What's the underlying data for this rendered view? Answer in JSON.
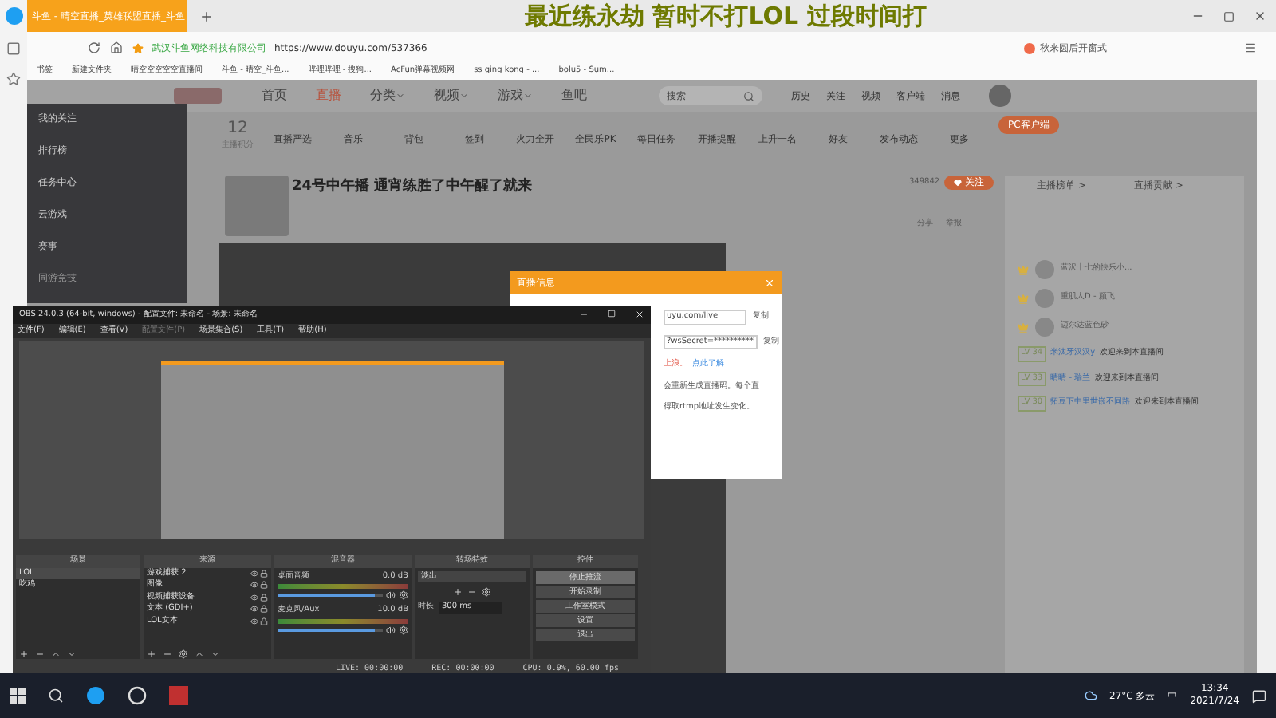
{
  "browser": {
    "tab_title": "斗鱼 - 晴空直播_英雄联盟直播_斗鱼",
    "caption": "最近练永劫 暂时不打LOL 过段时间打",
    "site_owner": "武汉斗鱼网络科技有限公司",
    "url": "https://www.douyu.com/537366",
    "promo": "秋来圆后开窗式",
    "bookmarks": [
      "书签",
      "新建文件夹",
      "晴空空空空空直播间",
      "斗鱼 - 晴空_斗鱼...",
      "哔哩哔哩 - 搜狗...",
      "AcFun弹幕视频网",
      "ss qing kong - ...",
      "bolu5 - Sum..."
    ]
  },
  "site_nav": {
    "items": [
      {
        "label": "首页",
        "selected": false,
        "dropdown": false
      },
      {
        "label": "直播",
        "selected": true,
        "dropdown": false
      },
      {
        "label": "分类",
        "selected": false,
        "dropdown": true
      },
      {
        "label": "视频",
        "selected": false,
        "dropdown": true
      },
      {
        "label": "游戏",
        "selected": false,
        "dropdown": true
      },
      {
        "label": "鱼吧",
        "selected": false,
        "dropdown": false
      }
    ],
    "search_placeholder": "搜索",
    "user_links": [
      "历史",
      "关注",
      "视频",
      "客户端",
      "消息"
    ]
  },
  "sidebar": {
    "items": [
      "我的关注",
      "排行榜",
      "任务中心",
      "云游戏",
      "赛事"
    ],
    "section": "同游竞技"
  },
  "toolbar": {
    "score": "12",
    "score_label": "主播积分",
    "items": [
      "直播严选",
      "音乐",
      "背包",
      "签到",
      "火力全开",
      "全民乐PK",
      "每日任务",
      "开播提醒",
      "上升一名",
      "好友",
      "发布动态",
      "更多"
    ],
    "client_button": "PC客户端"
  },
  "stream": {
    "title": "24号中午播 通宵练胜了中午醒了就来",
    "follow_count": "349842",
    "follow": "关注",
    "share": "分享",
    "report": "举报"
  },
  "rank_panel": {
    "links": [
      "主播榜单 >",
      "直播贡献 >"
    ],
    "users": [
      {
        "name": "蓝沢十七的快乐小..."
      },
      {
        "name": "重肌人D - 颜飞"
      },
      {
        "name": "迈尔达蓝色砂"
      }
    ],
    "chat": [
      {
        "level": "LV 34",
        "user": "米汰牙汉汉y",
        "text": "欢迎来到本直播间"
      },
      {
        "level": "LV 33",
        "user": "晴晴 - 瑞兰",
        "text": "欢迎来到本直播间"
      },
      {
        "level": "LV 30",
        "user": "拓豆下中里世嵌不同路",
        "text": "欢迎来到本直播间"
      }
    ]
  },
  "dialog": {
    "title": "直播信息",
    "server": "uyu.com/live",
    "key": "?wsSecret=**********",
    "copy_buttons": [
      "复制",
      "复制"
    ],
    "warning": "上浪。",
    "link": "点此了解",
    "notes": [
      "会重新生成直播码。每个直",
      "得取rtmp地址发生变化。"
    ]
  },
  "obs": {
    "title": "OBS 24.0.3 (64-bit, windows) - 配置文件: 未命名 - 场景: 未命名",
    "menu": [
      {
        "label": "文件(F)",
        "disabled": false
      },
      {
        "label": "编辑(E)",
        "disabled": false
      },
      {
        "label": "查看(V)",
        "disabled": false
      },
      {
        "label": "配置文件(P)",
        "disabled": true
      },
      {
        "label": "场景集合(S)",
        "disabled": false
      },
      {
        "label": "工具(T)",
        "disabled": false
      },
      {
        "label": "帮助(H)",
        "disabled": false
      }
    ],
    "docks": [
      "场景",
      "来源",
      "混音器",
      "转场特效",
      "控件"
    ],
    "scenes": [
      {
        "label": "LOL",
        "selected": true
      },
      {
        "label": "吃鸡",
        "selected": false
      }
    ],
    "sources": [
      "游戏捕获 2",
      "图像",
      "视频捕获设备",
      "文本 (GDI+)",
      "LOL文本"
    ],
    "mixer": [
      {
        "name": "桌面音频",
        "db": "0.0 dB",
        "level": 0.92
      },
      {
        "name": "麦克风/Aux",
        "db": "10.0 dB",
        "level": 0.92
      }
    ],
    "transition": "淡出",
    "duration_label": "时长",
    "duration": "300 ms",
    "controls": [
      {
        "label": "停止推流",
        "selected": true
      },
      {
        "label": "开始录制",
        "selected": false
      },
      {
        "label": "工作室模式",
        "selected": false
      },
      {
        "label": "设置",
        "selected": false
      },
      {
        "label": "退出",
        "selected": false
      }
    ],
    "status": [
      "LIVE: 00:00:00",
      "REC: 00:00:00",
      "CPU: 0.9%, 60.00 fps"
    ]
  },
  "taskbar": {
    "weather": "27°C 多云",
    "ime": "中",
    "time": "13:34",
    "date": "2021/7/24"
  }
}
